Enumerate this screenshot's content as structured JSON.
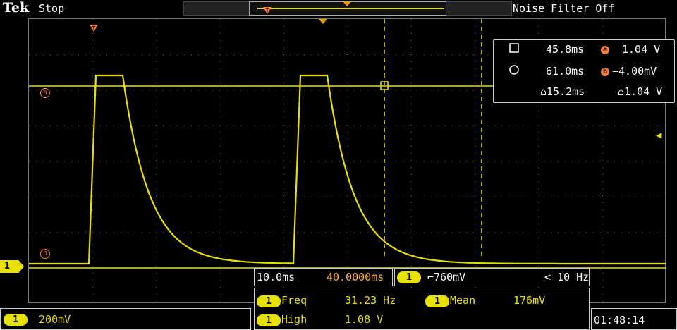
{
  "header": {
    "brand": "Tek",
    "acquisition_state": "Stop",
    "noise_filter": "Noise Filter Off"
  },
  "colors": {
    "trace": "#e8e000",
    "cursor_marker": "#ff7a29",
    "background": "#000000",
    "grid": "#777777"
  },
  "cursor_readout": {
    "a_time": "45.8ms",
    "a_marker": "a",
    "a_volt": "1.04 V",
    "b_time": "61.0ms",
    "b_marker": "b",
    "b_volt": "−4.00mV",
    "delta_time": "⌂15.2ms",
    "delta_volt": "⌂1.04 V"
  },
  "markers": {
    "channel": "1",
    "cursor_a": "a",
    "cursor_b": "b"
  },
  "horizontal": {
    "scale": "10.0ms",
    "position": "40.0000ms"
  },
  "trigger": {
    "channel": "1",
    "slope_level": "⌐760mV",
    "frequency": "< 10 Hz"
  },
  "measurements": [
    {
      "channel": "1",
      "name": "Freq",
      "value": "31.23 Hz"
    },
    {
      "channel": "1",
      "name": "Mean",
      "value": "176mV"
    },
    {
      "channel": "1",
      "name": "High",
      "value": "1.08 V"
    }
  ],
  "channel_scale": {
    "channel": "1",
    "volts_per_div": "200mV"
  },
  "clock": "01:48:14"
}
